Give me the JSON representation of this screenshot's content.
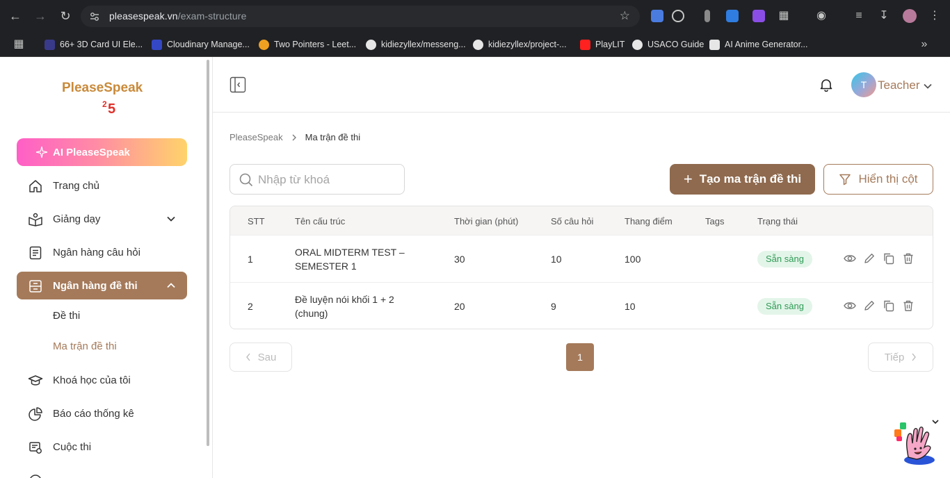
{
  "browser": {
    "url_host": "pleasespeak.vn",
    "url_path": "/exam-structure",
    "bookmarks": [
      {
        "label": "66+ 3D Card UI Ele...",
        "color": "#3a3a8a"
      },
      {
        "label": "Cloudinary Manage...",
        "color": "#3448c5"
      },
      {
        "label": "Two Pointers - Leet...",
        "color": "#f0a020"
      },
      {
        "label": "kidiezyllex/messeng...",
        "color": "#e6e6e6"
      },
      {
        "label": "kidiezyllex/project-...",
        "color": "#e6e6e6"
      },
      {
        "label": "PlayLIT",
        "color": "#ff2020"
      },
      {
        "label": "USACO Guide",
        "color": "#e6e6e6"
      },
      {
        "label": "AI Anime Generator...",
        "color": "#e6e6e6"
      }
    ]
  },
  "sidebar": {
    "ai_label": "AI PleaseSpeak",
    "items": [
      {
        "label": "Trang chủ",
        "icon": "home-icon"
      },
      {
        "label": "Giảng dạy",
        "icon": "teaching-icon"
      },
      {
        "label": "Ngân hàng câu hỏi",
        "icon": "question-bank-icon"
      },
      {
        "label": "Ngân hàng đề thi",
        "icon": "exam-bank-icon"
      },
      {
        "label": "Khoá học của tôi",
        "icon": "graduation-cap-icon"
      },
      {
        "label": "Báo cáo thống kê",
        "icon": "pie-chart-icon"
      },
      {
        "label": "Cuộc thi",
        "icon": "contest-icon"
      }
    ],
    "sub_items": [
      "Đề thi",
      "Ma trận đề thi"
    ]
  },
  "header": {
    "user_initial": "T",
    "user_name": "Teacher"
  },
  "breadcrumb": [
    "PleaseSpeak",
    "Ma trận đề thi"
  ],
  "search": {
    "placeholder": "Nhập từ khoá"
  },
  "actions": {
    "create_label": "Tạo ma trận đề thi",
    "columns_label": "Hiển thị cột"
  },
  "table": {
    "headers": [
      "STT",
      "Tên cấu trúc",
      "Thời gian (phút)",
      "Số câu hỏi",
      "Thang điểm",
      "Tags",
      "Trạng thái"
    ],
    "rows": [
      {
        "stt": "1",
        "name_line1": "ORAL MIDTERM TEST –",
        "name_line2": "SEMESTER 1",
        "time": "30",
        "questions": "10",
        "score": "100",
        "tags": "",
        "status": "Sẵn sàng"
      },
      {
        "stt": "2",
        "name_line1": "Đề luyện nói khối 1 + 2",
        "name_line2": "(chung)",
        "time": "20",
        "questions": "9",
        "score": "10",
        "tags": "",
        "status": "Sẵn sàng"
      }
    ]
  },
  "pagination": {
    "prev_label": "Sau",
    "current_page": "1",
    "next_label": "Tiếp"
  },
  "colors": {
    "brand": "#a57a5a",
    "brand_dark": "#8f6a4e",
    "status_bg": "#e3f5e9",
    "status_text": "#2e9a55"
  }
}
